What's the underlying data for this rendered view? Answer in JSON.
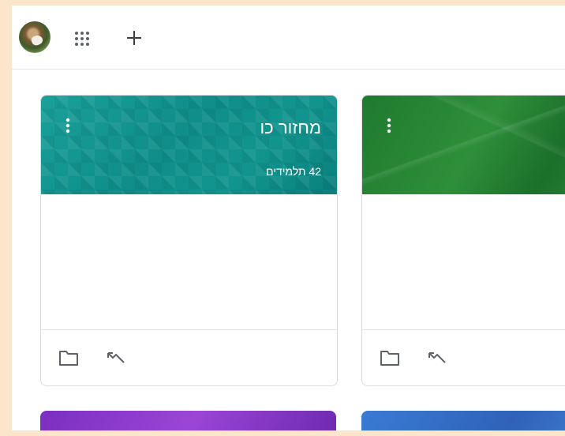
{
  "topbar": {
    "apps_icon": "apps-grid-icon",
    "add_icon": "plus-icon",
    "avatar": "user-avatar"
  },
  "cards": [
    {
      "title": "מחזור כו",
      "subtitle": "42 תלמידים",
      "banner_color": "#12958f",
      "menu_icon": "more-vert-icon",
      "footer_icons": [
        "folder-icon",
        "trending-icon"
      ]
    },
    {
      "title": "",
      "subtitle": "",
      "banner_color": "#2e8f3a",
      "menu_icon": "more-vert-icon",
      "footer_icons": [
        "folder-icon",
        "trending-icon"
      ]
    }
  ],
  "peek_cards": [
    {
      "banner_color": "#9a45d6"
    },
    {
      "banner_color": "#3a7bd5"
    }
  ]
}
